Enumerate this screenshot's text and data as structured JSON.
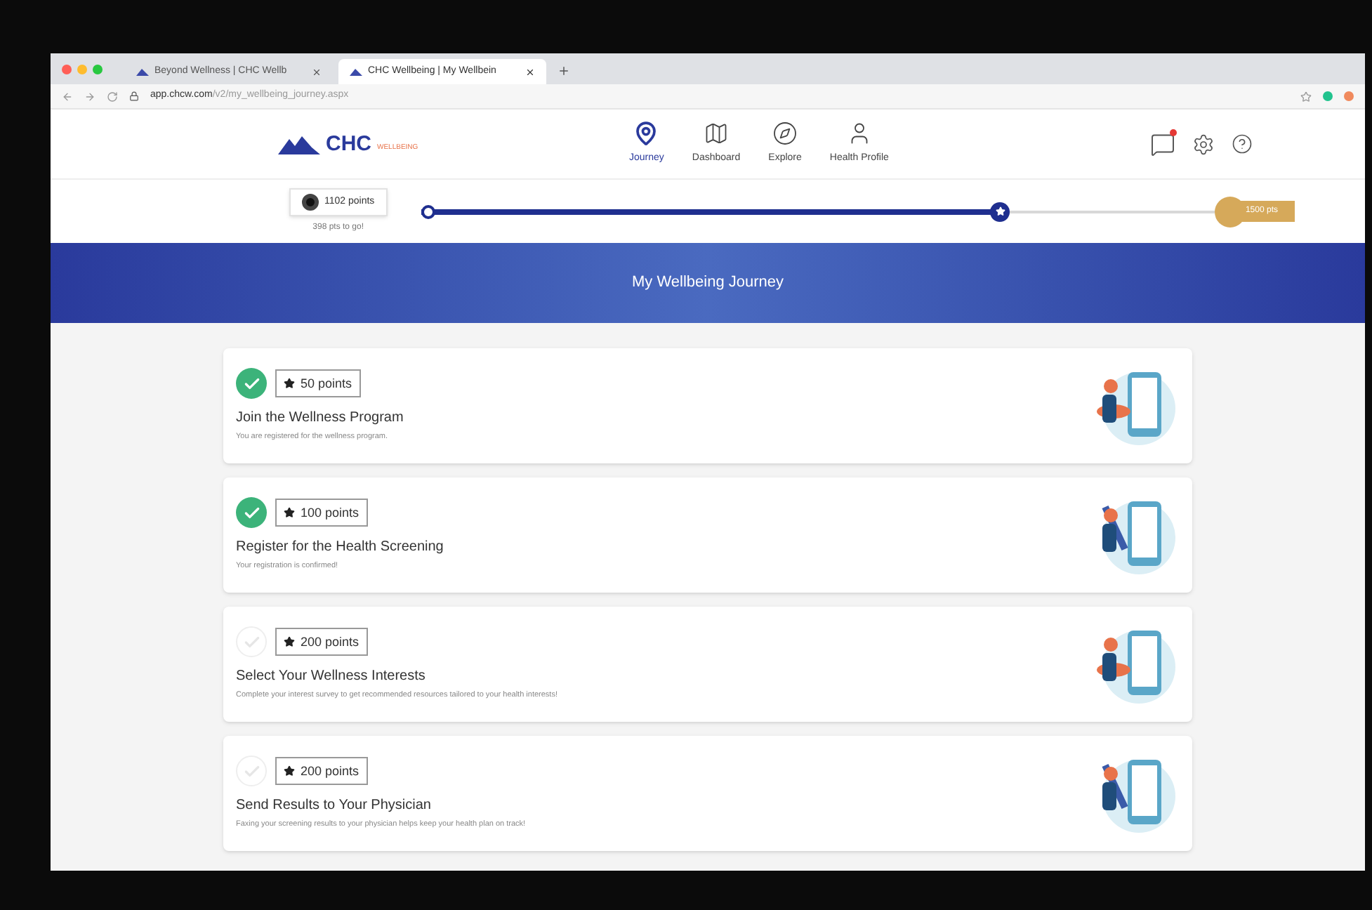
{
  "browser": {
    "tabs": [
      {
        "label": "Beyond Wellness | CHC Wellb",
        "selected": false
      },
      {
        "label": "CHC Wellbeing | My Wellbein",
        "selected": true
      }
    ],
    "url_host": "app.chcw.com",
    "url_path": "/v2/my_wellbeing_journey.aspx"
  },
  "header": {
    "logo": "CHC",
    "logo_sub": "WELLBEING",
    "nav": [
      {
        "label": "Journey",
        "selected": true,
        "kind": "pin"
      },
      {
        "label": "Dashboard",
        "selected": false,
        "kind": "map"
      },
      {
        "label": "Explore",
        "selected": false,
        "kind": "compass"
      },
      {
        "label": "Health Profile",
        "selected": false,
        "kind": "person"
      }
    ]
  },
  "progress": {
    "points": "1102 points",
    "to_go": "398 pts to go!",
    "level": 0.73,
    "goal": "1500 pts"
  },
  "banner": {
    "title": "My Wellbeing Journey"
  },
  "steps": [
    {
      "points": "50 points",
      "title": "Join the Wellness Program",
      "description": "You are registered for the wellness program.",
      "completed": true
    },
    {
      "points": "100 points",
      "title": "Register for the Health Screening",
      "description": "Your registration is confirmed!",
      "completed": true
    },
    {
      "points": "200 points",
      "title": "Select Your Wellness Interests",
      "description": "Complete your interest survey to get recommended resources tailored to your health interests!",
      "completed": false
    },
    {
      "points": "200 points",
      "title": "Send Results to Your Physician",
      "description": "Faxing your screening results to your physician helps keep your health plan on track!",
      "completed": false
    }
  ]
}
